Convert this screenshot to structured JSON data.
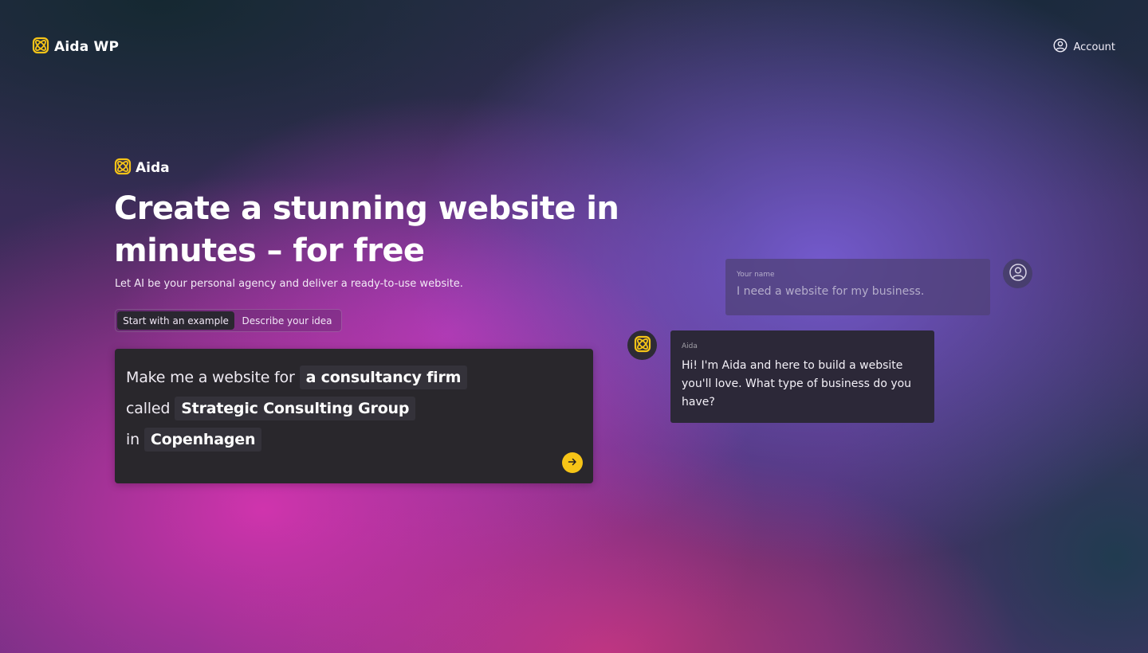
{
  "header": {
    "brand_name": "Aida WP",
    "account_label": "Account",
    "icons": {
      "brand": "aida-logo-icon",
      "account": "user-circle-icon"
    }
  },
  "hero": {
    "logo_text": "Aida",
    "headline_line1": "Create a stunning website in",
    "headline_line2": "minutes – for free",
    "subline": "Let AI be your personal agency and deliver a ready-to-use website."
  },
  "tabs": [
    {
      "label": "Start with an example",
      "active": true
    },
    {
      "label": "Describe your idea",
      "active": false
    }
  ],
  "prompt": {
    "line1_static": "Make me a website for",
    "line1_chip": "a consultancy firm",
    "line2_static": "called",
    "line2_chip": "Strategic Consulting Group",
    "line3_static": "in",
    "line3_chip": "Copenhagen",
    "send_icon": "arrow-right-icon"
  },
  "chat": {
    "user": {
      "label": "Your name",
      "text": "I need a website for my business.",
      "avatar_icon": "user-circle-icon"
    },
    "aida": {
      "label": "Aida",
      "text": "Hi! I'm Aida and here to build a website you'll love. What type of business do you have?",
      "avatar_icon": "aida-logo-icon"
    }
  },
  "colors": {
    "accent_yellow": "#f6c417",
    "card_dark": "#29272c",
    "chip_bg": "#34323a"
  }
}
